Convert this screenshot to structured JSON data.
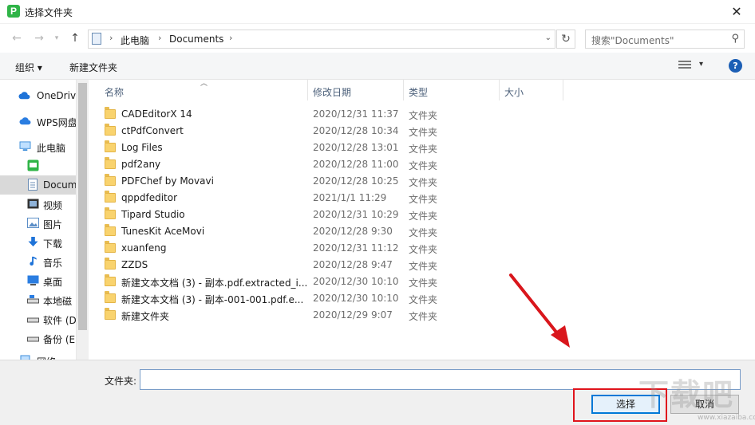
{
  "window": {
    "title": "选择文件夹",
    "app_icon_letter": "P",
    "close_glyph": "✕"
  },
  "navigation": {
    "breadcrumb": [
      "此电脑",
      "Documents"
    ],
    "search_placeholder": "搜索\"Documents\""
  },
  "toolbar": {
    "organize": "组织 ▾",
    "new_folder": "新建文件夹",
    "help": "?"
  },
  "sidebar": {
    "items": [
      {
        "label": "OneDrive",
        "icon": "cloud-icon",
        "color": "#1e73d8"
      },
      {
        "label": "WPS网盘",
        "icon": "wps-cloud-icon",
        "color": "#2a7de1"
      },
      {
        "label": "此电脑",
        "icon": "computer-icon",
        "color": "#3c8dd9"
      },
      {
        "label": "",
        "icon": "pdf-app-icon",
        "color": "#2fb447"
      },
      {
        "label": "Docum",
        "icon": "document-icon",
        "color": "#6a8db4",
        "selected": true
      },
      {
        "label": "视频",
        "icon": "video-icon",
        "color": "#444444"
      },
      {
        "label": "图片",
        "icon": "pictures-icon",
        "color": "#5b8ec7"
      },
      {
        "label": "下载",
        "icon": "download-icon",
        "color": "#1e73d8"
      },
      {
        "label": "音乐",
        "icon": "music-icon",
        "color": "#1e73d8"
      },
      {
        "label": "桌面",
        "icon": "desktop-icon",
        "color": "#2a7de1"
      },
      {
        "label": "本地磁",
        "icon": "drive-icon",
        "color": "#555555"
      },
      {
        "label": "软件 (D",
        "icon": "drive-icon",
        "color": "#555555"
      },
      {
        "label": "备份 (E",
        "icon": "drive-icon",
        "color": "#555555"
      },
      {
        "label": "网络",
        "icon": "network-icon",
        "color": "#3c8dd9"
      }
    ]
  },
  "file_list": {
    "columns": [
      "名称",
      "修改日期",
      "类型",
      "大小"
    ],
    "rows": [
      {
        "name": "CADEditorX 14",
        "date": "2020/12/31 11:37",
        "type": "文件夹"
      },
      {
        "name": "ctPdfConvert",
        "date": "2020/12/28 10:34",
        "type": "文件夹"
      },
      {
        "name": "Log Files",
        "date": "2020/12/28 13:01",
        "type": "文件夹"
      },
      {
        "name": "pdf2any",
        "date": "2020/12/28 11:00",
        "type": "文件夹"
      },
      {
        "name": "PDFChef by Movavi",
        "date": "2020/12/28 10:25",
        "type": "文件夹"
      },
      {
        "name": "qppdfeditor",
        "date": "2021/1/1 11:29",
        "type": "文件夹"
      },
      {
        "name": "Tipard Studio",
        "date": "2020/12/31 10:29",
        "type": "文件夹"
      },
      {
        "name": "TunesKit AceMovi",
        "date": "2020/12/28 9:30",
        "type": "文件夹"
      },
      {
        "name": "xuanfeng",
        "date": "2020/12/31 11:12",
        "type": "文件夹"
      },
      {
        "name": "ZZDS",
        "date": "2020/12/28 9:47",
        "type": "文件夹"
      },
      {
        "name": "新建文本文档 (3) - 副本.pdf.extracted_i...",
        "date": "2020/12/30 10:10",
        "type": "文件夹"
      },
      {
        "name": "新建文本文档 (3) - 副本-001-001.pdf.e...",
        "date": "2020/12/30 10:10",
        "type": "文件夹"
      },
      {
        "name": "新建文件夹",
        "date": "2020/12/29 9:07",
        "type": "文件夹"
      }
    ]
  },
  "bottom": {
    "folder_label": "文件夹:",
    "folder_value": "",
    "select_button": "选择",
    "cancel_button": "取消"
  },
  "watermark": {
    "text": "下载吧",
    "url": "www.xiazaiba.com"
  },
  "colors": {
    "accent": "#0078d7",
    "highlight": "#e0141c",
    "folder": "#f9d36e"
  }
}
